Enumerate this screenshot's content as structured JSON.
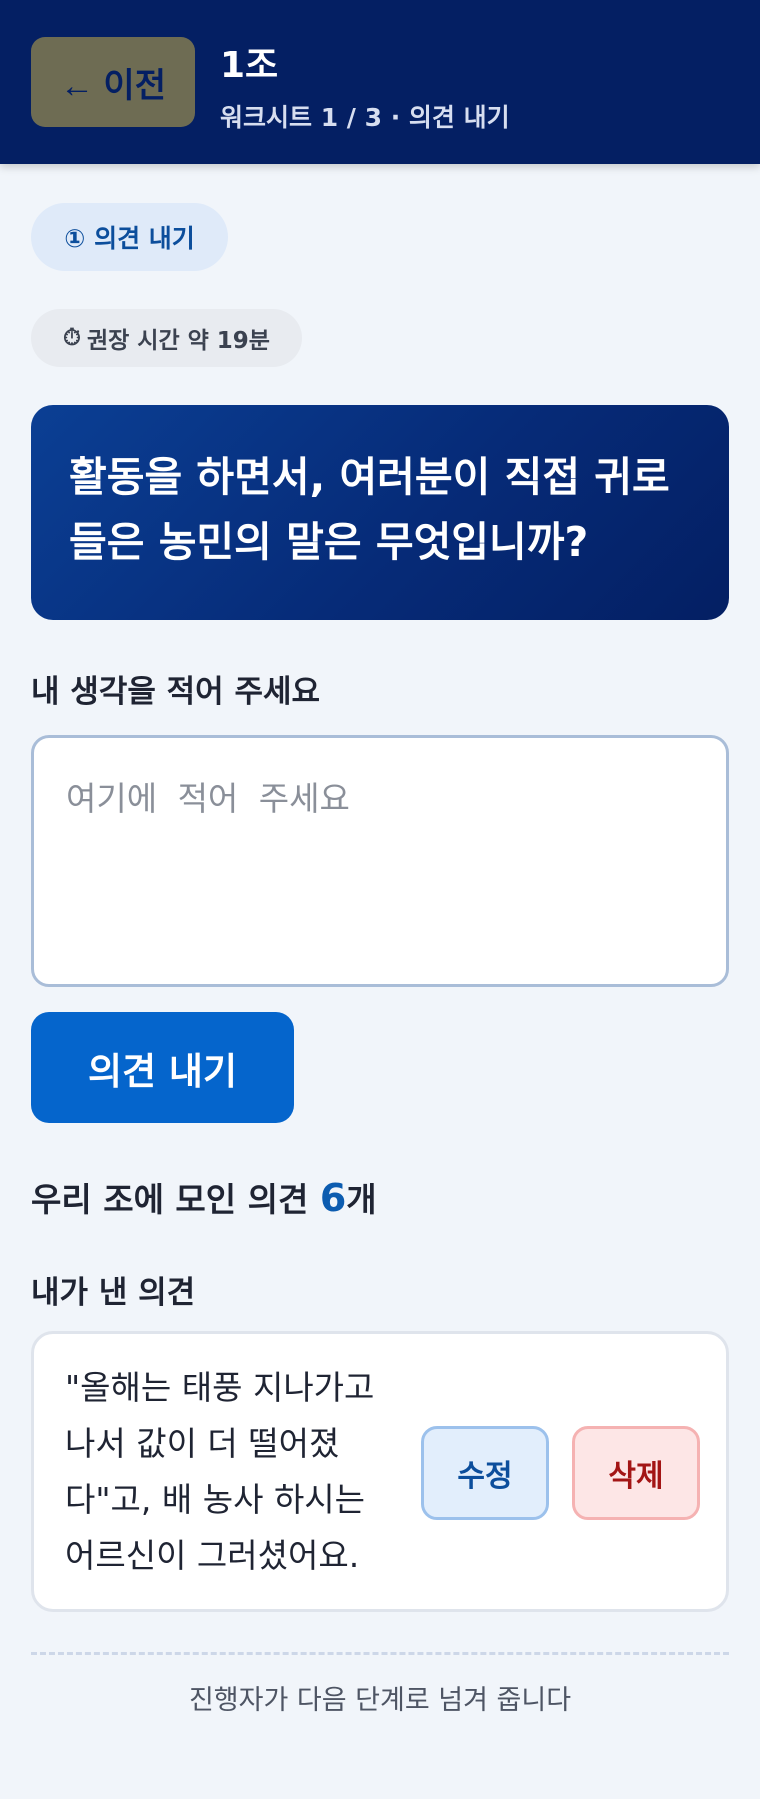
{
  "header": {
    "back_label": "← 이전",
    "title": "1조",
    "subtitle": "워크시트 1 / 3 · 의견 내기"
  },
  "step": {
    "label": "① 의견 내기"
  },
  "timer": {
    "icon": "stopwatch-icon",
    "symbol": "⏱",
    "label": "권장 시간 약 19분"
  },
  "question": {
    "text": "활동을 하면서, 여러분이 직접 귀로 들은 농민의 말은 무엇입니까?"
  },
  "input": {
    "label": "내 생각을 적어 주세요",
    "placeholder": "여기에 적어 주세요",
    "value": ""
  },
  "submit": {
    "label": "의견 내기"
  },
  "count": {
    "prefix": "우리 조에 모인 의견 ",
    "number": "6",
    "suffix": "개"
  },
  "mine": {
    "label": "내가 낸 의견",
    "opinion": "\"올해는 태풍 지나가고 나서 값이 더 떨어졌다\"고, 배 농사 하시는 어르신이 그러셨어요.",
    "edit_label": "수정",
    "delete_label": "삭제"
  },
  "footer": {
    "note": "진행자가 다음 단계로 넘겨 줍니다"
  },
  "colors": {
    "header_bg": "#041f63",
    "accent": "#0565cc",
    "count_number": "#0c5cb0",
    "delete": "#a31515"
  }
}
